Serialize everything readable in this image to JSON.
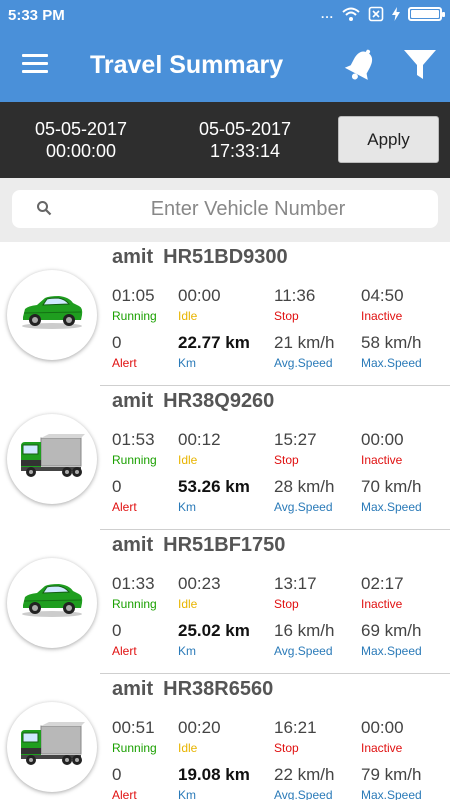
{
  "status_bar": {
    "time": "5:33 PM",
    "dots": "...",
    "battery_level": 1.0
  },
  "app_bar": {
    "title": "Travel Summary"
  },
  "date_range": {
    "from_date": "05-05-2017",
    "from_time": "00:00:00",
    "to_date": "05-05-2017",
    "to_time": "17:33:14",
    "apply_label": "Apply"
  },
  "search": {
    "placeholder": "Enter Vehicle Number",
    "value": ""
  },
  "labels": {
    "running": "Running",
    "idle": "Idle",
    "stop": "Stop",
    "inactive": "Inactive",
    "alert": "Alert",
    "km": "Km",
    "avg_speed": "Avg.Speed",
    "max_speed": "Max.Speed"
  },
  "vehicles": [
    {
      "owner": "amit",
      "number": "HR51BD9300",
      "icon": "car-icon",
      "running": "01:05",
      "idle": "00:00",
      "stop": "11:36",
      "inactive": "04:50",
      "alert": "0",
      "km": "22.77 km",
      "avg_speed": "21 km/h",
      "max_speed": "58 km/h"
    },
    {
      "owner": "amit",
      "number": "HR38Q9260",
      "icon": "truck-icon",
      "running": "01:53",
      "idle": "00:12",
      "stop": "15:27",
      "inactive": "00:00",
      "alert": "0",
      "km": "53.26 km",
      "avg_speed": "28 km/h",
      "max_speed": "70 km/h"
    },
    {
      "owner": "amit",
      "number": "HR51BF1750",
      "icon": "car-icon",
      "running": "01:33",
      "idle": "00:23",
      "stop": "13:17",
      "inactive": "02:17",
      "alert": "0",
      "km": "25.02 km",
      "avg_speed": "16 km/h",
      "max_speed": "69 km/h"
    },
    {
      "owner": "amit",
      "number": "HR38R6560",
      "icon": "truck-icon",
      "running": "00:51",
      "idle": "00:20",
      "stop": "16:21",
      "inactive": "00:00",
      "alert": "0",
      "km": "19.08 km",
      "avg_speed": "22 km/h",
      "max_speed": "79 km/h"
    }
  ]
}
